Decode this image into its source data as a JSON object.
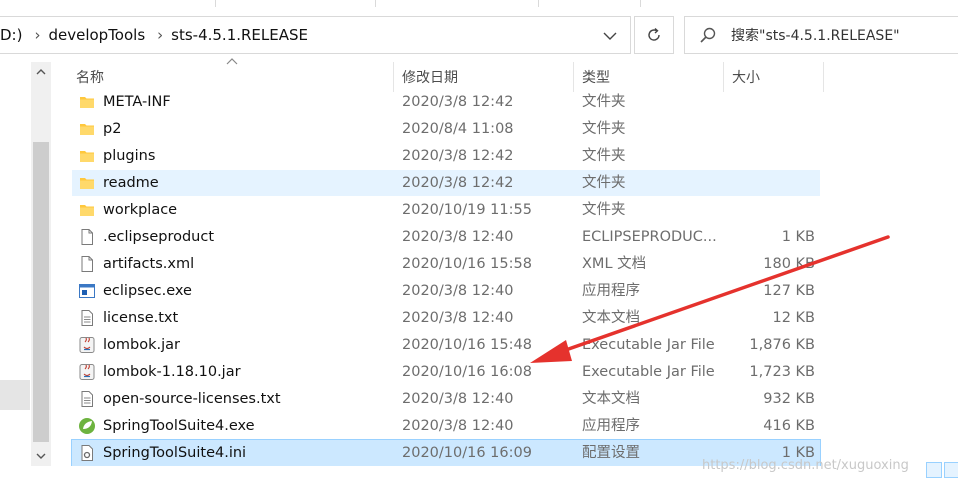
{
  "address": {
    "crumbs": [
      "D:)",
      "developTools",
      "sts-4.5.1.RELEASE"
    ]
  },
  "search": {
    "placeholder": "搜索\"sts-4.5.1.RELEASE\""
  },
  "columns": {
    "name": "名称",
    "date": "修改日期",
    "type": "类型",
    "size": "大小"
  },
  "files": [
    {
      "name": "META-INF",
      "date": "2020/3/8 12:42",
      "type": "文件夹",
      "size": "",
      "icon": "folder-icon"
    },
    {
      "name": "p2",
      "date": "2020/8/4 11:08",
      "type": "文件夹",
      "size": "",
      "icon": "folder-icon"
    },
    {
      "name": "plugins",
      "date": "2020/3/8 12:42",
      "type": "文件夹",
      "size": "",
      "icon": "folder-icon"
    },
    {
      "name": "readme",
      "date": "2020/3/8 12:42",
      "type": "文件夹",
      "size": "",
      "icon": "folder-icon"
    },
    {
      "name": "workplace",
      "date": "2020/10/19 11:55",
      "type": "文件夹",
      "size": "",
      "icon": "folder-icon"
    },
    {
      "name": ".eclipseproduct",
      "date": "2020/3/8 12:40",
      "type": "ECLIPSEPRODUC...",
      "size": "1 KB",
      "icon": "file-icon"
    },
    {
      "name": "artifacts.xml",
      "date": "2020/10/16 15:58",
      "type": "XML 文档",
      "size": "180 KB",
      "icon": "file-icon"
    },
    {
      "name": "eclipsec.exe",
      "date": "2020/3/8 12:40",
      "type": "应用程序",
      "size": "127 KB",
      "icon": "exe-window-icon"
    },
    {
      "name": "license.txt",
      "date": "2020/3/8 12:40",
      "type": "文本文档",
      "size": "12 KB",
      "icon": "text-file-icon"
    },
    {
      "name": "lombok.jar",
      "date": "2020/10/16 15:48",
      "type": "Executable Jar File",
      "size": "1,876 KB",
      "icon": "jar-file-icon"
    },
    {
      "name": "lombok-1.18.10.jar",
      "date": "2020/10/16 16:08",
      "type": "Executable Jar File",
      "size": "1,723 KB",
      "icon": "jar-file-icon"
    },
    {
      "name": "open-source-licenses.txt",
      "date": "2020/3/8 12:40",
      "type": "文本文档",
      "size": "932 KB",
      "icon": "text-file-icon"
    },
    {
      "name": "SpringToolSuite4.exe",
      "date": "2020/3/8 12:40",
      "type": "应用程序",
      "size": "416 KB",
      "icon": "spring-leaf-icon"
    },
    {
      "name": "SpringToolSuite4.ini",
      "date": "2020/10/16 16:09",
      "type": "配置设置",
      "size": "1 KB",
      "icon": "settings-file-icon"
    }
  ],
  "watermark": "https://blog.csdn.net/xuguoxing",
  "colors": {
    "hover": "#e5f3ff",
    "selected": "#cce8ff",
    "arrow": "#e5322d",
    "folder": "#ffc83d"
  }
}
